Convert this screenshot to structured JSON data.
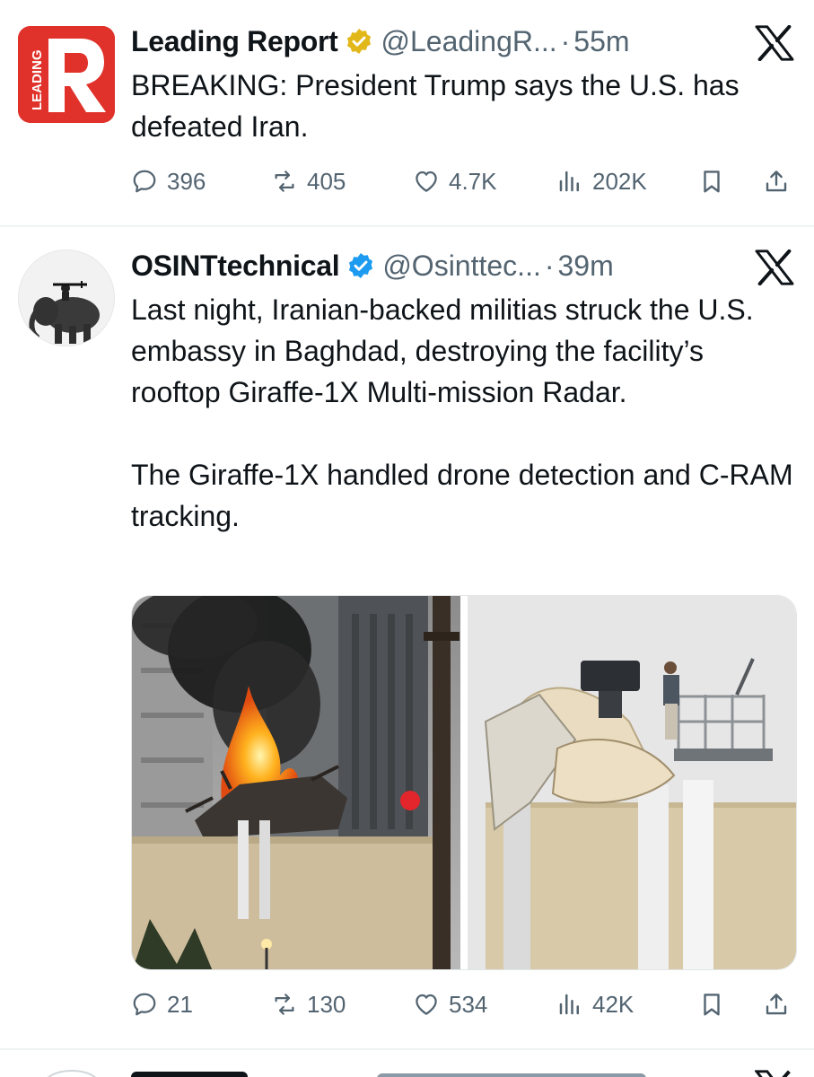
{
  "tweets": [
    {
      "name": "Leading Report",
      "handle": "@LeadingR...",
      "separator": "·",
      "time": "55m",
      "avatar_text": "LEADING",
      "avatar_letter": "R",
      "badge": "gold-verified-icon",
      "text": "BREAKING: President Trump says the U.S. has defeated Iran.",
      "stats": {
        "replies": "396",
        "reposts": "405",
        "likes": "4.7K",
        "views": "202K"
      }
    },
    {
      "name": "OSINTtechnical",
      "handle": "@Osinttec...",
      "separator": "·",
      "time": "39m",
      "badge": "blue-verified-icon",
      "text": "Last night, Iranian-backed militias struck the U.S. embassy in Baghdad, destroying the facility’s rooftop Giraffe-1X Multi-mission Radar.\n\nThe Giraffe-1X handled drone detection and C-RAM tracking.",
      "stats": {
        "replies": "21",
        "reposts": "130",
        "likes": "534",
        "views": "42K"
      }
    }
  ],
  "colors": {
    "text": "#0f1419",
    "secondary": "#536471",
    "divider": "#eff3f4",
    "brand_red": "#e0322b",
    "verified_blue": "#1d9bf0",
    "verified_gold": "#e2b719"
  },
  "icons": [
    "reply-icon",
    "repost-icon",
    "like-icon",
    "views-icon",
    "bookmark-icon",
    "share-icon",
    "x-logo-icon"
  ]
}
